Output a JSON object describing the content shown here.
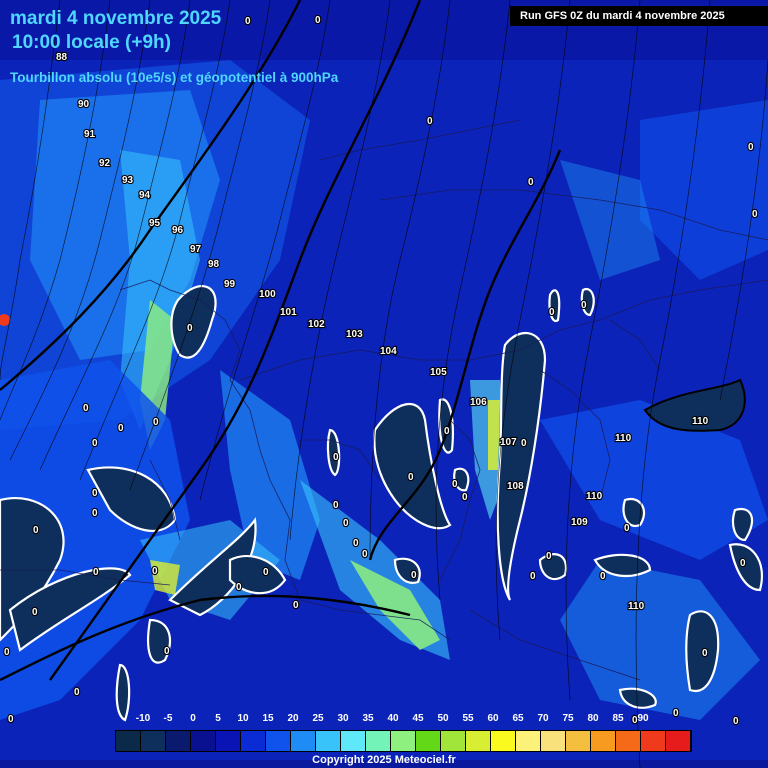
{
  "header": {
    "date_line": "mardi 4 novembre 2025",
    "time_line": "10:00 locale (+9h)",
    "parameter_line": "Tourbillon absolu (10e5/s) et géopotentiel à 900hPa",
    "run_info": "Run GFS 0Z du mardi 4 novembre 2025"
  },
  "geopotential_labels": [
    "88",
    "90",
    "91",
    "92",
    "93",
    "94",
    "95",
    "96",
    "97",
    "98",
    "99",
    "100",
    "101",
    "102",
    "103",
    "104",
    "105",
    "106",
    "107",
    "108",
    "109",
    "110",
    "110",
    "110",
    "110"
  ],
  "vorticity_zero_labels_count": 40,
  "color_scale": {
    "labels": [
      "-10",
      "-5",
      "0",
      "5",
      "10",
      "15",
      "20",
      "25",
      "30",
      "35",
      "40",
      "45",
      "50",
      "55",
      "60",
      "65",
      "70",
      "75",
      "80",
      "85",
      "90"
    ],
    "colors": [
      "#0b2a4a",
      "#0e2f5c",
      "#0a1a6e",
      "#0a1190",
      "#0a14b4",
      "#0b2cd4",
      "#0f52ec",
      "#1f8cf6",
      "#39c3fb",
      "#5ee8fa",
      "#74f3b8",
      "#8ef07e",
      "#62d818",
      "#a2e53a",
      "#d8ee32",
      "#fafa1e",
      "#fcf27a",
      "#f8e07a",
      "#f4bf3e",
      "#f69a20",
      "#f46a18",
      "#f03a1c",
      "#e61c1c"
    ]
  },
  "copyright": "Copyright 2025 Meteociel.fr"
}
